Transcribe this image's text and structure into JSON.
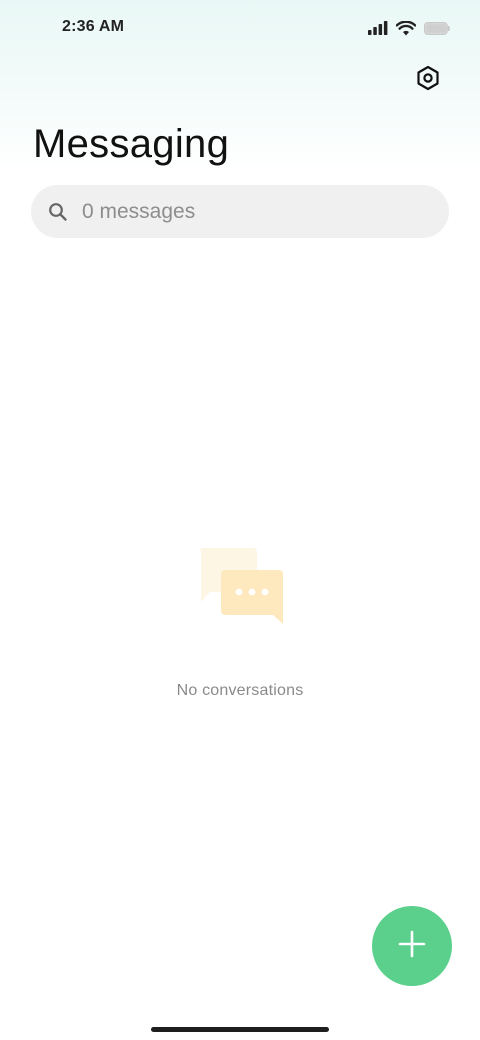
{
  "status_bar": {
    "time": "2:36 AM",
    "signal_icon": "cellular-signal-icon",
    "wifi_icon": "wifi-icon",
    "battery_icon": "battery-icon"
  },
  "header": {
    "title": "Messaging",
    "settings_icon": "settings-hexagon-icon"
  },
  "search": {
    "placeholder": "0 messages",
    "value": "",
    "icon": "search-icon"
  },
  "empty_state": {
    "icon": "chat-bubbles-icon",
    "text": "No conversations"
  },
  "fab": {
    "icon": "plus-icon",
    "color": "#5bcf8c"
  },
  "colors": {
    "accent": "#5bcf8c",
    "illustration": "#fde9bd"
  }
}
